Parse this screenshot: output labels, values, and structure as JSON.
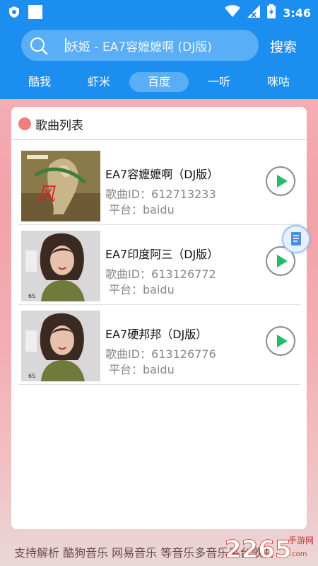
{
  "status_bar": {
    "time": "3:46",
    "left_icons": [
      "shield-icon",
      "square-icon"
    ],
    "right_icons": [
      "wifi-icon",
      "signal-icon",
      "battery-icon"
    ]
  },
  "search": {
    "icon": "search-icon",
    "value": "妖姬 - EA7容嬷嬷啊 (DJ版)",
    "button_label": "搜索"
  },
  "tabs": [
    {
      "label": "酷我",
      "active": false
    },
    {
      "label": "虾米",
      "active": false
    },
    {
      "label": "百度",
      "active": true
    },
    {
      "label": "一听",
      "active": false
    },
    {
      "label": "咪咕",
      "active": false
    }
  ],
  "panel": {
    "title": "歌曲列表"
  },
  "songs": [
    {
      "name": "EA7容嬷嬷啊（DJ版）",
      "id_text": "歌曲ID：612713233",
      "platform_text": "平台：baidu"
    },
    {
      "name": "EA7印度阿三（DJ版）",
      "id_text": "歌曲ID：613126772",
      "platform_text": "平台：baidu"
    },
    {
      "name": "EA7硬邦邦（DJ版）",
      "id_text": "歌曲ID：613126776",
      "platform_text": "平台：baidu"
    }
  ],
  "footer": {
    "text": "支持解析 酷狗音乐 网易音乐 等音乐多音乐平台歌曲"
  },
  "watermark": {
    "brand": "2265",
    "sub": "手游网",
    "url": ".com"
  },
  "colors": {
    "primary": "#1c8ef0",
    "tab_active": "#5aaef6",
    "play_green": "#1fbe6a",
    "dot": "#f47c7c"
  }
}
